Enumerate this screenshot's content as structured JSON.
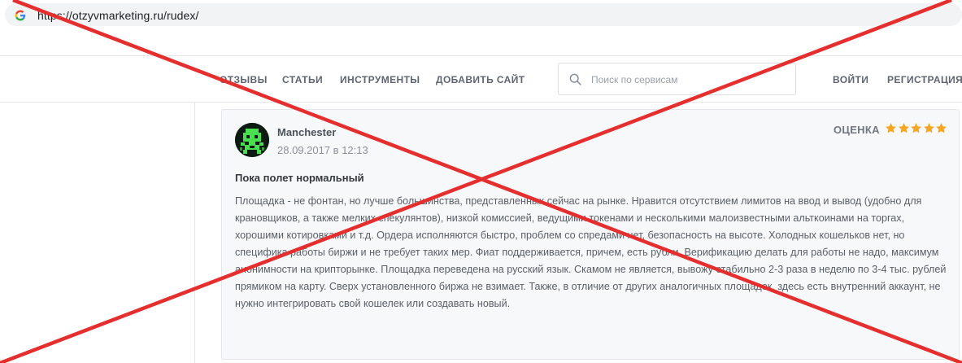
{
  "browser": {
    "url": "https://otzyvmarketing.ru/rudex/",
    "favicon_icon": "google-g-icon"
  },
  "nav": {
    "reviews": "ОТЗЫВЫ",
    "articles": "СТАТЬИ",
    "tools": "ИНСТРУМЕНТЫ",
    "add_site": "ДОБАВИТЬ САЙТ",
    "login": "ВОЙТИ",
    "register": "РЕГИСТРАЦИЯ"
  },
  "search": {
    "placeholder": "Поиск по сервисам",
    "icon": "search-icon"
  },
  "review": {
    "author": "Manchester",
    "date": "28.09.2017 в 12:13",
    "rating_label": "ОЦЕНКА",
    "rating": 5,
    "rating_max": 5,
    "title": "Пока полет нормальный",
    "body": "Площадка - не фонтан, но лучше большинства, представленных сейчас на рынке. Нравится отсутствием лимитов на ввод и вывод (удобно для крановщиков, а также мелких спекулянтов), низкой комиссией, ведущими токенами и несколькими малоизвестными альткоинами на торгах, хорошими котировками и т.д. Ордера исполняются быстро, проблем со спредами нет, безопасность на высоте. Холодных кошельков нет, но специфика работы биржи и не требует таких мер. Фиат поддерживается, причем, есть рубли. Верификацию делать для работы не надо, максимум анонимности на крипторынке. Площадка переведена на русский язык. Скамом не является, вывожу стабильно 2-3 раза в неделю по 3-4 тыс. рублей прямиком на карту. Сверх установленного биржа не взимает. Также, в отличие от других аналогичных площадок, здесь есть внутренний аккаунт, не нужно интегрировать свой кошелек или создавать новый."
  },
  "colors": {
    "star": "#f5a623",
    "cross": "#e52e2e",
    "avatar_bg": "#0c1b12",
    "avatar_fg": "#49e04f"
  }
}
